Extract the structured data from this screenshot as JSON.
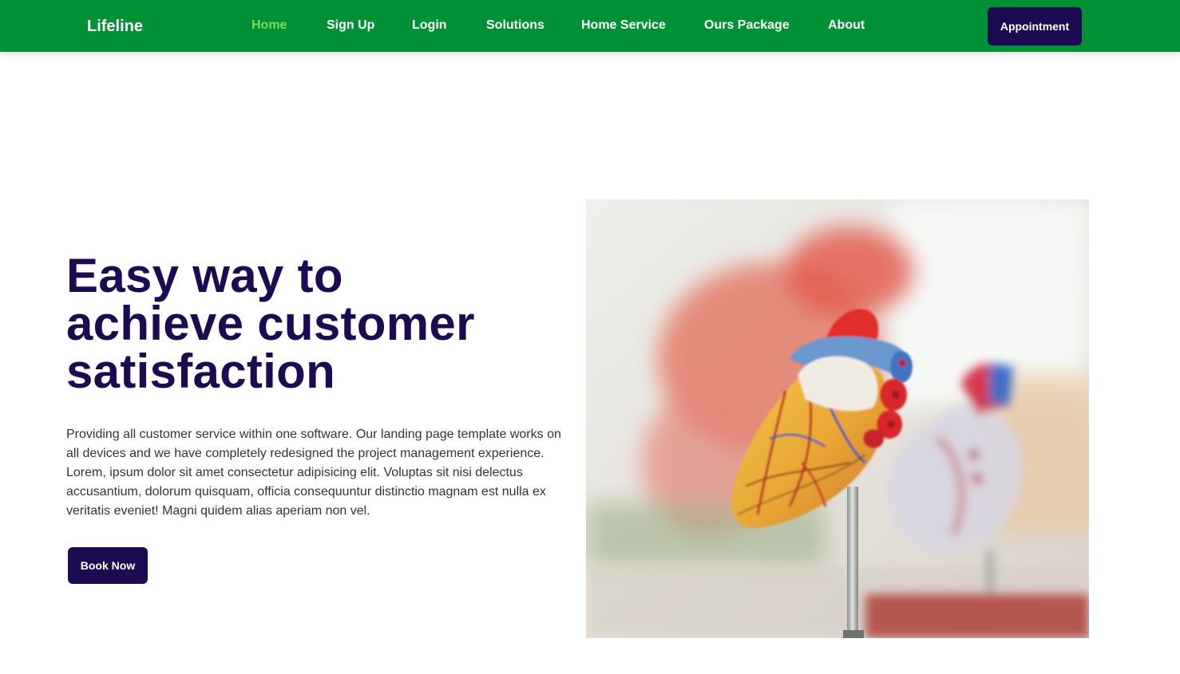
{
  "navbar": {
    "brand": "Lifeline",
    "links": [
      {
        "label": "Home",
        "active": true
      },
      {
        "label": "Sign Up",
        "active": false
      },
      {
        "label": "Login",
        "active": false
      },
      {
        "label": "Solutions",
        "active": false
      },
      {
        "label": "Home Service",
        "active": false
      },
      {
        "label": "Ours Package",
        "active": false
      },
      {
        "label": "About",
        "active": false
      }
    ],
    "appointment_label": "Appointment"
  },
  "hero": {
    "title_lines": [
      "Easy way to",
      "achieve customer",
      "satisfaction"
    ],
    "description": "Providing all customer service within one software. Our landing page template works on all devices and we have completely redesigned the project management experience. Lorem, ipsum dolor sit amet consectetur adipisicing elit. Voluptas sit nisi delectus accusantium, dolorum quisquam, officia consequuntur distinctio magnam est nulla ex veritatis eveniet! Magni quidem alias aperiam non vel.",
    "cta_label": "Book Now",
    "image": "anatomical-heart-model-photo"
  },
  "colors": {
    "navbar_bg": "#009035",
    "active_link": "#7ddc5b",
    "primary_dark": "#1d0b52",
    "body_text": "#333333"
  }
}
